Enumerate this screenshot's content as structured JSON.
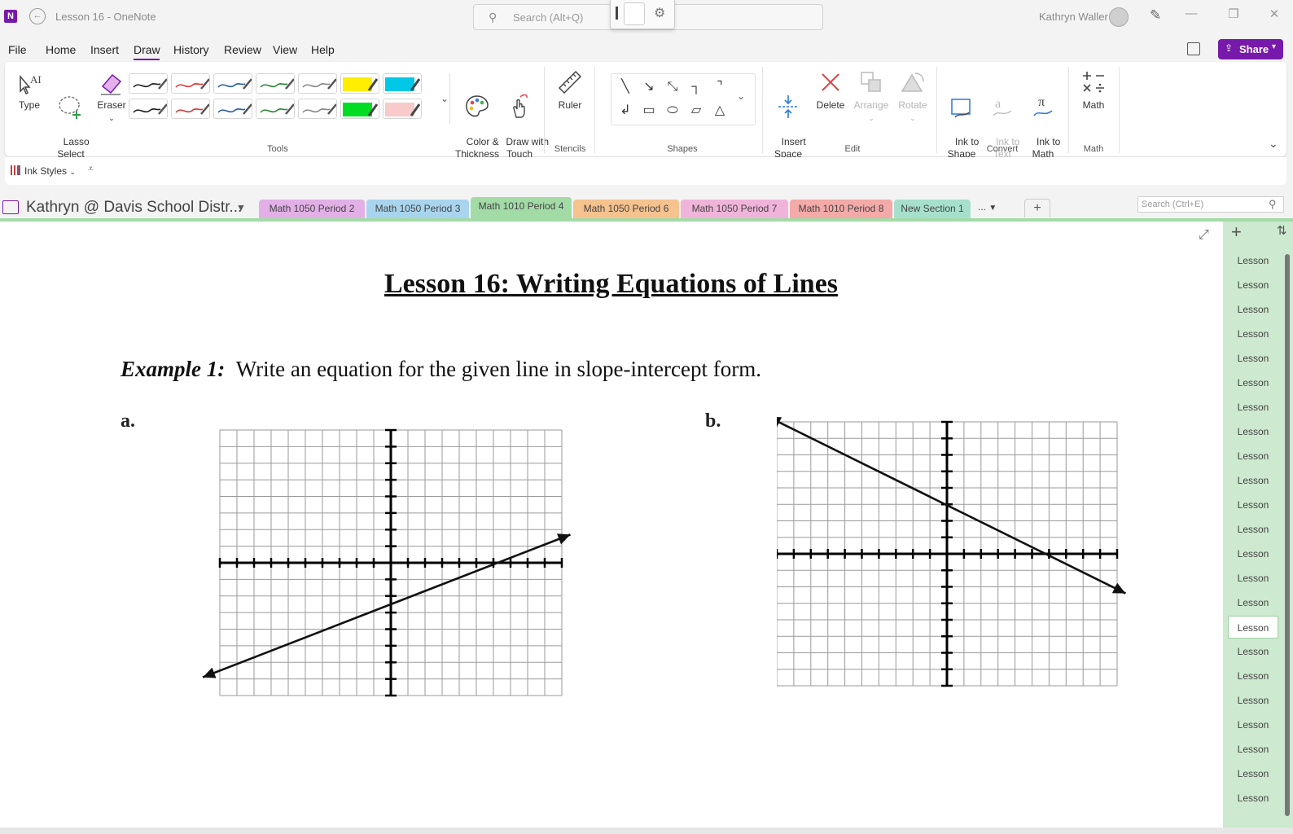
{
  "titlebar": {
    "app_icon": "N",
    "title": "Lesson 16  -  OneNote",
    "search_placeholder": "Search (Alt+Q)",
    "user_name": "Kathryn Waller",
    "icons": [
      "back-icon",
      "search-icon",
      "gear-icon",
      "avatar",
      "pen-icon",
      "minimize-icon",
      "restore-icon",
      "close-icon"
    ]
  },
  "menu": {
    "items": [
      "File",
      "Home",
      "Insert",
      "Draw",
      "History",
      "Review",
      "View",
      "Help"
    ],
    "active": "Draw",
    "share_label": "Share"
  },
  "ribbon": {
    "type_label": "Type",
    "lasso_label": "Lasso\nSelect",
    "eraser_label": "Eraser",
    "color_label": "Color &\nThickness",
    "touch_label": "Draw with\nTouch",
    "ruler_label": "Ruler",
    "insert_space_label": "Insert\nSpace",
    "delete_label": "Delete",
    "arrange_label": "Arrange",
    "rotate_label": "Rotate",
    "ink_shape_label": "Ink to\nShape",
    "ink_text_label": "Ink to\nText",
    "ink_math_label": "Ink to\nMath",
    "math_label": "Math",
    "groups": {
      "tools": "Tools",
      "stencils": "Stencils",
      "shapes": "Shapes",
      "edit": "Edit",
      "convert": "Convert",
      "math": "Math"
    },
    "pens": [
      "#222222",
      "#d93a3a",
      "#2c5ea8",
      "#2c8a3a",
      "#888888",
      "#ffee00",
      "#00c8e6",
      "#222222",
      "#d93a3a",
      "#2c5ea8",
      "#2c8a3a",
      "#888888",
      "#00dd22",
      "#f8caca"
    ],
    "ink_styles_label": "Ink Styles"
  },
  "notebook": {
    "name": "Kathryn @ Davis School Distr...",
    "sections": [
      {
        "label": "Math 1050 Period 2",
        "color": "#e2b0e6"
      },
      {
        "label": "Math 1050 Period 3",
        "color": "#a9d4ee"
      },
      {
        "label": "Math 1010 Period 4",
        "color": "#a3dba7"
      },
      {
        "label": "Math 1050 Period 6",
        "color": "#f6c28e"
      },
      {
        "label": "Math 1050 Period 7",
        "color": "#f0b4da"
      },
      {
        "label": "Math 1010 Period 8",
        "color": "#f3aaa8"
      },
      {
        "label": "New Section 1",
        "color": "#a6e0cc"
      }
    ],
    "active_section": "Math 1010 Period 4",
    "more_label": "...",
    "add_label": "+",
    "search_placeholder": "Search (Ctrl+E)"
  },
  "page": {
    "title": "Lesson 16:  Writing Equations of Lines",
    "example_label": "Example 1:",
    "example_text": "Write an equation for the given line in slope-intercept form.",
    "label_a": "a.",
    "label_b": "b.",
    "graph_a": {
      "type": "line",
      "xlim": [
        -10,
        10
      ],
      "ylim": [
        -8,
        8
      ],
      "slope": 0.4,
      "y_intercept": -2.5,
      "endpoints": [
        [
          -11,
          -6.9
        ],
        [
          10.5,
          1.7
        ]
      ]
    },
    "graph_b": {
      "type": "line",
      "xlim": [
        -10,
        10
      ],
      "ylim": [
        -8,
        8
      ],
      "slope": -0.5,
      "y_intercept": 3,
      "endpoints": [
        [
          -10.5,
          8.3
        ],
        [
          10.5,
          -2.4
        ]
      ]
    }
  },
  "pagelist": {
    "items": [
      "Lesson",
      "Lesson",
      "Lesson",
      "Lesson",
      "Lesson",
      "Lesson",
      "Lesson",
      "Lesson",
      "Lesson",
      "Lesson",
      "Lesson",
      "Lesson",
      "Lesson",
      "Lesson",
      "Lesson",
      "Lesson",
      "Lesson",
      "Lesson",
      "Lesson",
      "Lesson",
      "Lesson",
      "Lesson",
      "Lesson"
    ],
    "selected_index": 15
  }
}
